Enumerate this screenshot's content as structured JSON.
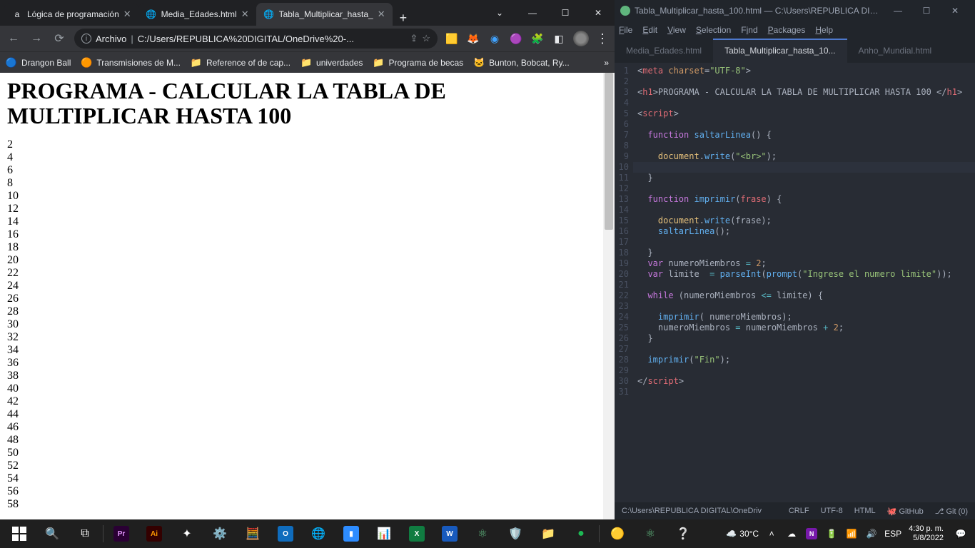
{
  "chrome": {
    "tabs": [
      {
        "favicon": "a",
        "label": "Lógica de programación"
      },
      {
        "favicon": "🌐",
        "label": "Media_Edades.html"
      },
      {
        "favicon": "🌐",
        "label": "Tabla_Multiplicar_hasta_"
      }
    ],
    "omnibox": {
      "label": "Archivo",
      "url": "C:/Users/REPUBLICA%20DIGITAL/OneDrive%20-..."
    },
    "bookmarks": [
      {
        "icon": "🔵",
        "label": "Drangon Ball"
      },
      {
        "icon": "🟠",
        "label": "Transmisiones de M..."
      },
      {
        "icon": "📁",
        "label": "Reference of de cap..."
      },
      {
        "icon": "📁",
        "label": "univerdades"
      },
      {
        "icon": "📁",
        "label": "Programa de becas"
      },
      {
        "icon": "🐱",
        "label": "Bunton, Bobcat, Ry..."
      }
    ],
    "page": {
      "heading": "PROGRAMA - CALCULAR LA TABLA DE MULTIPLICAR HASTA 100",
      "lines": [
        "2",
        "4",
        "6",
        "8",
        "10",
        "12",
        "14",
        "16",
        "18",
        "20",
        "22",
        "24",
        "26",
        "28",
        "30",
        "32",
        "34",
        "36",
        "38",
        "40",
        "42",
        "44",
        "46",
        "48",
        "50",
        "52",
        "54",
        "56",
        "58"
      ]
    }
  },
  "atom": {
    "title": "Tabla_Multiplicar_hasta_100.html — C:\\Users\\REPUBLICA DIGI...",
    "menu": [
      "File",
      "Edit",
      "View",
      "Selection",
      "Find",
      "Packages",
      "Help"
    ],
    "tabs": [
      {
        "label": "Media_Edades.html",
        "active": false
      },
      {
        "label": "Tabla_Multiplicar_hasta_10...",
        "active": true
      },
      {
        "label": "Anho_Mundial.html",
        "active": false
      }
    ],
    "gutter_start": 1,
    "gutter_end": 31,
    "status": {
      "path": "C:\\Users\\REPUBLICA DIGITAL\\OneDriv",
      "eol": "CRLF",
      "enc": "UTF-8",
      "lang": "HTML",
      "gh": "GitHub",
      "git": "Git (0)"
    }
  },
  "taskbar": {
    "weather": "30°C",
    "lang": "ESP",
    "time": "4:30 p. m.",
    "date": "5/8/2022"
  }
}
